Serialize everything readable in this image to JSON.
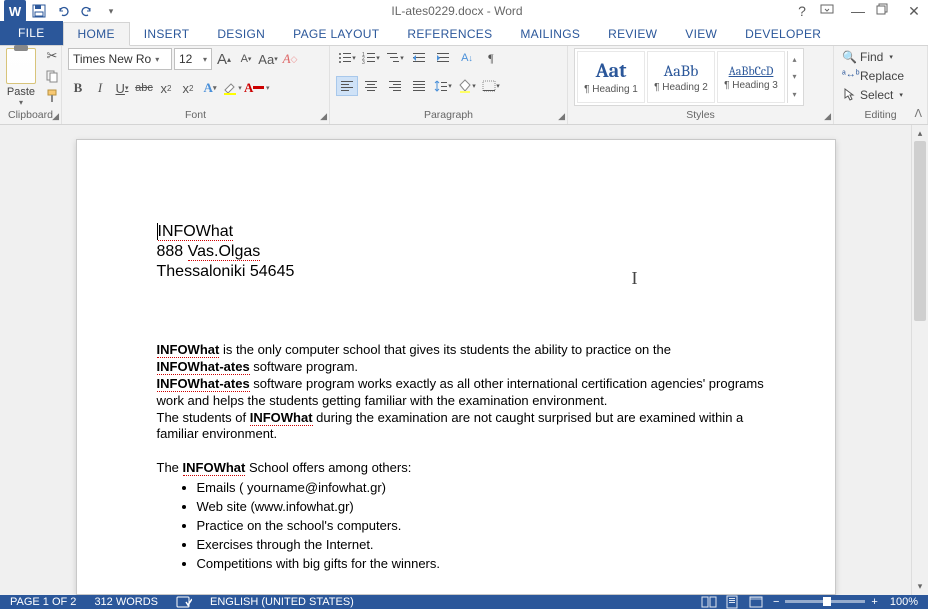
{
  "titlebar": {
    "app_icon_letter": "W",
    "doc_title": "IL-ates0229.docx - Word",
    "help": "?"
  },
  "tabs": {
    "file": "FILE",
    "home": "HOME",
    "insert": "INSERT",
    "design": "DESIGN",
    "page_layout": "PAGE LAYOUT",
    "references": "REFERENCES",
    "mailings": "MAILINGS",
    "review": "REVIEW",
    "view": "VIEW",
    "developer": "DEVELOPER"
  },
  "ribbon": {
    "clipboard": {
      "paste": "Paste",
      "label": "Clipboard"
    },
    "font": {
      "name": "Times New Ro",
      "size": "12",
      "grow": "A",
      "shrink": "A",
      "case": "Aa",
      "b": "B",
      "i": "I",
      "u": "U",
      "strike": "abc",
      "sub": "x",
      "sup": "x",
      "label": "Font"
    },
    "paragraph": {
      "label": "Paragraph"
    },
    "styles": {
      "items": [
        {
          "preview": "Aat",
          "name": "¶ Heading 1",
          "big": true
        },
        {
          "preview": "AaBb",
          "name": "¶ Heading 2",
          "big": false
        },
        {
          "preview": "AaBbCcD",
          "name": "¶ Heading 3",
          "big": false
        }
      ],
      "label": "Styles"
    },
    "editing": {
      "find": "Find",
      "replace": "Replace",
      "select": "Select",
      "label": "Editing"
    }
  },
  "document": {
    "header": {
      "l1": "INFOWhat",
      "l2a": "888 ",
      "l2b": "Vas.Olgas",
      "l3": "Thessaloniki 54645"
    },
    "body": {
      "p1a": "INFOWhat",
      "p1b": " is the only computer school that gives its students the ability to practice on the ",
      "p1c": "INFOWhat-ates",
      "p1d": " software program.",
      "p2a": "INFOWhat-ates",
      "p2b": " software program works exactly as all other international certification agencies' programs work and helps the students getting familiar with the examination environment.",
      "p3a": "The students of ",
      "p3b": "INFOWhat",
      "p3c": " during the examination are not caught surprised but are examined within a familiar environment.",
      "p4a": "The ",
      "p4b": "INFOWhat",
      "p4c": " School offers among others:",
      "bullets": [
        "Emails ( yourname@infowhat.gr)",
        "Web site (www.infowhat.gr)",
        "Practice on the school's computers.",
        "Exercises through the Internet.",
        "Competitions with big gifts for the winners."
      ]
    }
  },
  "status": {
    "page": "PAGE 1 OF 2",
    "words": "312 WORDS",
    "lang": "ENGLISH (UNITED STATES)",
    "zoom_minus": "−",
    "zoom_plus": "+",
    "zoom": "100%"
  }
}
